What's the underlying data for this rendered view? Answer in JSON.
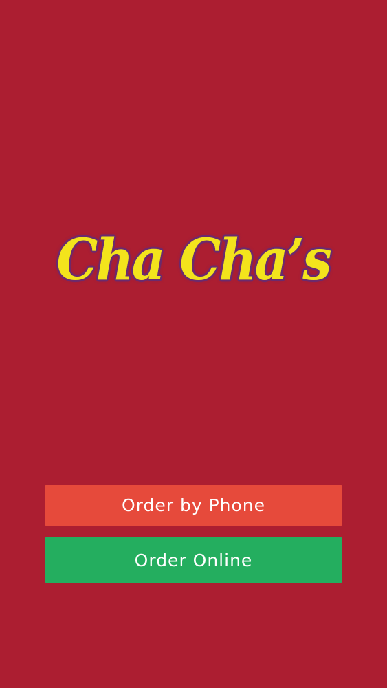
{
  "brand": {
    "logo_text": "Cha Cha’s"
  },
  "actions": {
    "order_by_phone_label": "Order by Phone",
    "order_online_label": "Order Online"
  },
  "colors": {
    "background": "#ac1e31",
    "logo_fill": "#f3e41c",
    "logo_outline": "#6b2a6e",
    "phone_button": "#e64a3b",
    "online_button": "#24ae5f",
    "button_text": "#ffffff"
  }
}
